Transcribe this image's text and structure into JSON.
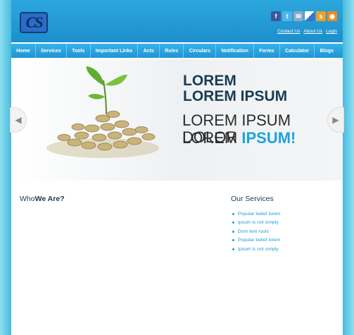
{
  "logo": {
    "text": "CS"
  },
  "social_icons": [
    "facebook-icon",
    "twitter-icon",
    "email-icon",
    "delicious-icon",
    "stumbleupon-icon",
    "rss-icon"
  ],
  "toplinks": [
    "Contact Us",
    "About Us",
    "Login"
  ],
  "nav": [
    "Home",
    "Services",
    "Tools",
    "Important Links",
    "Acts",
    "Rules",
    "Circulars",
    "Notification",
    "Forms",
    "Calculator",
    "Blogs"
  ],
  "banner": {
    "line1": "LOREM",
    "line2": "LOREM IPSUM",
    "line3": "LOREM IPSUM DOLOR",
    "line4_plain": "LOREM ",
    "line4_accent": "IPSUM!"
  },
  "who": {
    "plain": "Who",
    "bold": "We Are?"
  },
  "services": {
    "title": "Our Services",
    "items": [
      "Popular belief lorem",
      "Ipsum is not simply",
      "Dom text roots",
      "Popular belief lorem",
      "Ipsum is not simply"
    ]
  }
}
